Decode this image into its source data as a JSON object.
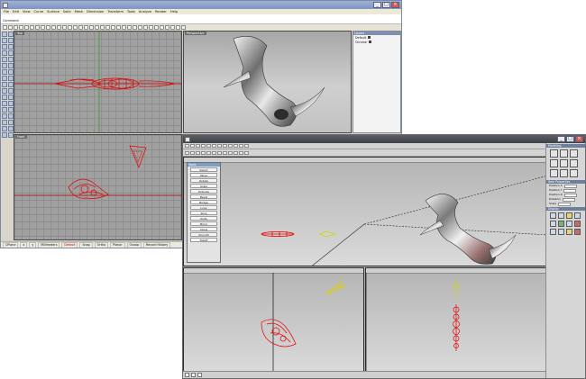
{
  "rhino": {
    "title": "",
    "menu": [
      "File",
      "Edit",
      "View",
      "Curve",
      "Surface",
      "Solid",
      "Mesh",
      "Dimension",
      "Transform",
      "Tools",
      "Analyze",
      "Render",
      "Help"
    ],
    "command_history": "",
    "command_prompt": "Command:",
    "viewports": {
      "top": "Top",
      "perspective": "Perspective",
      "front": "Front"
    },
    "layers_panel": {
      "title": "Layers",
      "rows": [
        {
          "name": "Default",
          "color": "#c80000"
        },
        {
          "name": "Chrome",
          "color": "#c80000"
        }
      ]
    },
    "status": {
      "cplane": "CPlane",
      "coord_x": "x",
      "coord_y": "y",
      "units": "Millimeters",
      "layer": "Default",
      "snap": "Snap",
      "ortho": "Ortho",
      "planar": "Planar",
      "osnap": "Osnap",
      "record": "Record History"
    }
  },
  "modo": {
    "title": "",
    "toolbox": {
      "title": "Tools",
      "items": [
        "Select",
        "Move",
        "Rotate",
        "Scale",
        "Extrude",
        "Bevel",
        "Bridge",
        "Loop",
        "Slice",
        "Knife",
        "Mirror",
        "Clone",
        "Smooth",
        "Falloff"
      ]
    },
    "right_panel": {
      "sections": [
        "Modeling",
        "Item Properties",
        "Display"
      ],
      "fields": [
        "Position X",
        "Position Y",
        "Position Z",
        "Rotation",
        "Scale"
      ]
    }
  },
  "colors": {
    "wire": "#e80000",
    "wire_yellow": "#d6d300",
    "axis_green": "#2f9e2f",
    "axis_red": "#b00000"
  },
  "icons": {
    "close": "x-icon",
    "max": "maximize-icon",
    "min": "minimize-icon"
  }
}
